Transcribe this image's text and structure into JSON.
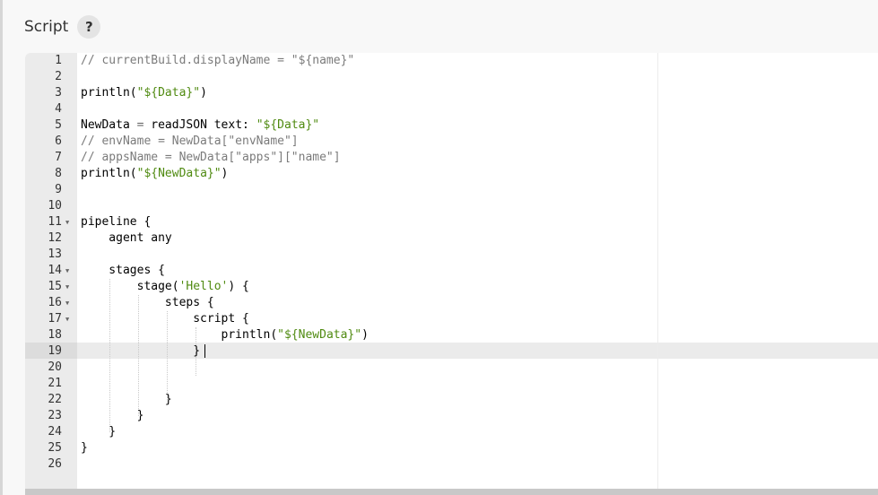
{
  "header": {
    "title": "Script",
    "help_label": "?"
  },
  "editor": {
    "lines": [
      {
        "no": "1",
        "fold": false,
        "tokens": [
          {
            "t": "// currentBuild.displayName = \"${name}\"",
            "c": "comment"
          }
        ]
      },
      {
        "no": "2",
        "fold": false,
        "tokens": []
      },
      {
        "no": "3",
        "fold": false,
        "tokens": [
          {
            "t": "println(",
            "c": ""
          },
          {
            "t": "\"${Data}\"",
            "c": "string"
          },
          {
            "t": ")",
            "c": ""
          }
        ]
      },
      {
        "no": "4",
        "fold": false,
        "tokens": []
      },
      {
        "no": "5",
        "fold": false,
        "tokens": [
          {
            "t": "NewData ",
            "c": ""
          },
          {
            "t": "=",
            "c": "op"
          },
          {
            "t": " readJSON text: ",
            "c": ""
          },
          {
            "t": "\"${Data}\"",
            "c": "string"
          }
        ]
      },
      {
        "no": "6",
        "fold": false,
        "tokens": [
          {
            "t": "// envName = NewData[\"envName\"]",
            "c": "comment"
          }
        ]
      },
      {
        "no": "7",
        "fold": false,
        "tokens": [
          {
            "t": "// appsName = NewData[\"apps\"][\"name\"]",
            "c": "comment"
          }
        ]
      },
      {
        "no": "8",
        "fold": false,
        "tokens": [
          {
            "t": "println(",
            "c": ""
          },
          {
            "t": "\"${NewData}\"",
            "c": "string"
          },
          {
            "t": ")",
            "c": ""
          }
        ]
      },
      {
        "no": "9",
        "fold": false,
        "tokens": []
      },
      {
        "no": "10",
        "fold": false,
        "tokens": []
      },
      {
        "no": "11",
        "fold": true,
        "tokens": [
          {
            "t": "pipeline {",
            "c": ""
          }
        ]
      },
      {
        "no": "12",
        "fold": false,
        "tokens": [
          {
            "t": "    agent any",
            "c": ""
          }
        ]
      },
      {
        "no": "13",
        "fold": false,
        "tokens": []
      },
      {
        "no": "14",
        "fold": true,
        "tokens": [
          {
            "t": "    stages {",
            "c": ""
          }
        ]
      },
      {
        "no": "15",
        "fold": true,
        "tokens": [
          {
            "t": "        stage(",
            "c": ""
          },
          {
            "t": "'Hello'",
            "c": "string"
          },
          {
            "t": ") {",
            "c": ""
          }
        ]
      },
      {
        "no": "16",
        "fold": true,
        "tokens": [
          {
            "t": "            steps {",
            "c": ""
          }
        ]
      },
      {
        "no": "17",
        "fold": true,
        "tokens": [
          {
            "t": "                script {",
            "c": ""
          }
        ]
      },
      {
        "no": "18",
        "fold": false,
        "tokens": [
          {
            "t": "                    println(",
            "c": ""
          },
          {
            "t": "\"${NewData}\"",
            "c": "string"
          },
          {
            "t": ")",
            "c": ""
          }
        ]
      },
      {
        "no": "19",
        "fold": false,
        "tokens": [
          {
            "t": "                }",
            "c": ""
          }
        ]
      },
      {
        "no": "20",
        "fold": false,
        "tokens": []
      },
      {
        "no": "21",
        "fold": false,
        "tokens": []
      },
      {
        "no": "22",
        "fold": false,
        "tokens": [
          {
            "t": "            }",
            "c": ""
          }
        ]
      },
      {
        "no": "23",
        "fold": false,
        "tokens": [
          {
            "t": "        }",
            "c": ""
          }
        ]
      },
      {
        "no": "24",
        "fold": false,
        "tokens": [
          {
            "t": "    }",
            "c": ""
          }
        ]
      },
      {
        "no": "25",
        "fold": false,
        "tokens": [
          {
            "t": "}",
            "c": ""
          }
        ]
      },
      {
        "no": "26",
        "fold": false,
        "tokens": []
      }
    ],
    "active_line": "19",
    "fold_icon": "fold-arrow-icon"
  },
  "colors": {
    "comment": "#7b7b7b",
    "string": "#4f8a10",
    "gutter": "#ebebeb",
    "active_line": "#ebebeb"
  }
}
